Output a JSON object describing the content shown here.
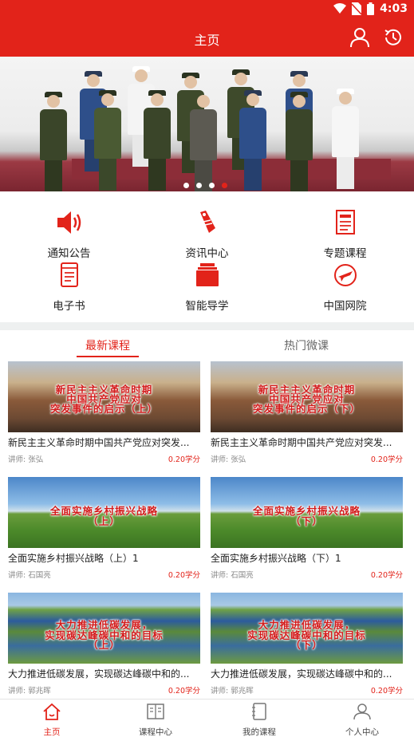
{
  "status_bar": {
    "time": "4:03"
  },
  "app_bar": {
    "title": "主页"
  },
  "banner": {
    "slide_count": 4,
    "active_slide": 4
  },
  "quick_menu": [
    {
      "label": "通知公告",
      "icon": "speaker-icon"
    },
    {
      "label": "资讯中心",
      "icon": "tag-icon"
    },
    {
      "label": "专题课程",
      "icon": "document-icon"
    },
    {
      "label": "电子书",
      "icon": "book-icon"
    },
    {
      "label": "智能导学",
      "icon": "folder-icon"
    },
    {
      "label": "中国网院",
      "icon": "plane-circle-icon"
    }
  ],
  "tabs": [
    {
      "label": "最新课程",
      "active": true
    },
    {
      "label": "热门微课",
      "active": false
    }
  ],
  "courses": [
    {
      "thumb_lines": [
        "新民主主义革命时期",
        "中国共产党应对",
        "突发事件的启示（上）"
      ],
      "title": "新民主主义革命时期中国共产党应对突发...",
      "teacher": "讲师:  张弘",
      "credit": "0.20学分"
    },
    {
      "thumb_lines": [
        "新民主主义革命时期",
        "中国共产党应对",
        "突发事件的启示（下）"
      ],
      "title": "新民主主义革命时期中国共产党应对突发...",
      "teacher": "讲师:  张弘",
      "credit": "0.20学分"
    },
    {
      "thumb_lines": [
        "全面实施乡村振兴战略",
        "（上）"
      ],
      "title": "全面实施乡村振兴战略（上）1",
      "teacher": "讲师:  石国亮",
      "credit": "0.20学分"
    },
    {
      "thumb_lines": [
        "全面实施乡村振兴战略",
        "（下）"
      ],
      "title": "全面实施乡村振兴战略（下）1",
      "teacher": "讲师:  石国亮",
      "credit": "0.20学分"
    },
    {
      "thumb_lines": [
        "大力推进低碳发展，",
        "实现碳达峰碳中和的目标",
        "（上）"
      ],
      "title": "大力推进低碳发展，实现碳达峰碳中和的...",
      "teacher": "讲师:  郭兆晖",
      "credit": "0.20学分"
    },
    {
      "thumb_lines": [
        "大力推进低碳发展，",
        "实现碳达峰碳中和的目标",
        "（下）"
      ],
      "title": "大力推进低碳发展，实现碳达峰碳中和的...",
      "teacher": "讲师:  郭兆晖",
      "credit": "0.20学分"
    }
  ],
  "bottom_nav": [
    {
      "label": "主页",
      "icon": "home-icon",
      "active": true
    },
    {
      "label": "课程中心",
      "icon": "open-book-icon",
      "active": false
    },
    {
      "label": "我的课程",
      "icon": "notebook-icon",
      "active": false
    },
    {
      "label": "个人中心",
      "icon": "person-icon",
      "active": false
    }
  ],
  "colors": {
    "brand_red": "#e2231a",
    "separator": "#eef0f0"
  }
}
